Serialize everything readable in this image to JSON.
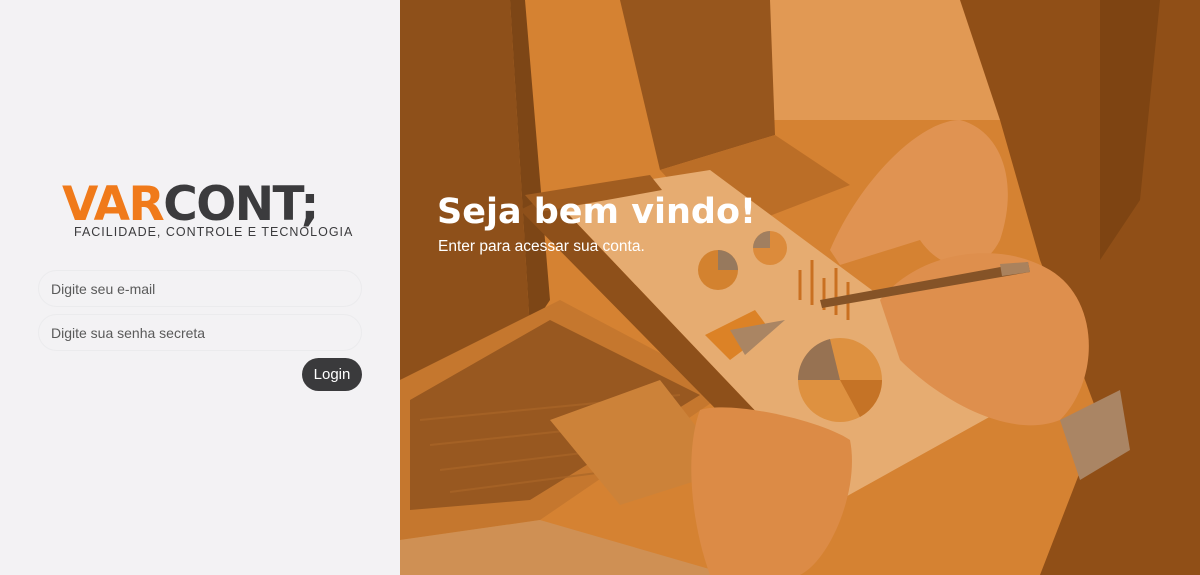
{
  "logo": {
    "brand_part1": "VAR",
    "brand_part2": "CONT;",
    "tagline": "FACILIDADE, CONTROLE E TECNOLOGIA",
    "accent_color": "#f07a1a",
    "dark_color": "#3b3b3d"
  },
  "form": {
    "email_placeholder": "Digite seu e-mail",
    "email_value": "",
    "password_placeholder": "Digite sua senha secreta",
    "password_value": "",
    "login_label": "Login"
  },
  "hero": {
    "title": "Seja bem vindo!",
    "subtitle": "Enter para acessar sua conta.",
    "overlay_color": "#d6781e"
  }
}
